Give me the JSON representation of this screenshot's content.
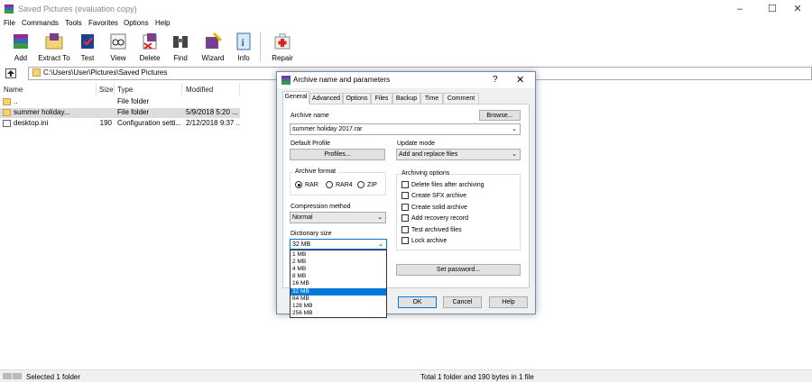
{
  "window": {
    "title": "Saved Pictures (evaluation copy)",
    "controls": [
      "–",
      "☐",
      "✕"
    ]
  },
  "menu": [
    "File",
    "Commands",
    "Tools",
    "Favorites",
    "Options",
    "Help"
  ],
  "toolbar": {
    "buttons": [
      {
        "label": "Add",
        "icon": "winrar-add-icon"
      },
      {
        "label": "Extract To",
        "icon": "extract-folder-icon"
      },
      {
        "label": "Test",
        "icon": "test-book-icon"
      },
      {
        "label": "View",
        "icon": "view-glasses-icon"
      },
      {
        "label": "Delete",
        "icon": "delete-icon"
      },
      {
        "label": "Find",
        "icon": "binoculars-icon"
      },
      {
        "label": "Wizard",
        "icon": "wizard-icon"
      },
      {
        "label": "Info",
        "icon": "info-icon"
      },
      {
        "label": "Repair",
        "icon": "first-aid-kit-icon"
      }
    ]
  },
  "address": {
    "path": "C:\\Users\\User\\Pictures\\Saved Pictures"
  },
  "filelist": {
    "columns": [
      "Name",
      "Size",
      "Type",
      "Modified"
    ],
    "rows": [
      {
        "name": "..",
        "size": "",
        "type": "File folder",
        "modified": "",
        "icon": "folder-icon"
      },
      {
        "name": "summer holiday...",
        "size": "",
        "type": "File folder",
        "modified": "5/9/2018 5:20 ...",
        "icon": "folder-icon"
      },
      {
        "name": "desktop.ini",
        "size": "190",
        "type": "Configuration setti...",
        "modified": "2/12/2018 9:37 ...",
        "icon": "settings-file-icon"
      }
    ]
  },
  "status": {
    "left": "Selected 1 folder",
    "right": "Total 1 folder and 190 bytes in 1 file"
  },
  "dialog": {
    "title": "Archive name and parameters",
    "help": "?",
    "close": "✕",
    "tabs": [
      "General",
      "Advanced",
      "Options",
      "Files",
      "Backup",
      "Time",
      "Comment"
    ],
    "archive_name_label": "Archive name",
    "browse_label": "Browse...",
    "archive_name_value": "summer holiday 2017.rar",
    "default_profile_label": "Default Profile",
    "profiles_label": "Profiles...",
    "update_mode_label": "Update mode",
    "update_mode_value": "Add and replace files",
    "archive_format_label": "Archive format",
    "formats": [
      "RAR",
      "RAR4",
      "ZIP"
    ],
    "selected_format": "RAR",
    "archiving_options_label": "Archiving options",
    "options": [
      "Delete files after archiving",
      "Create SFX archive",
      "Create solid archive",
      "Add recovery record",
      "Test archived files",
      "Lock archive"
    ],
    "compression_method_label": "Compression method",
    "compression_method_value": "Normal",
    "dictionary_size_label": "Dictionary size",
    "dictionary_size_value": "32 MB",
    "dictionary_options": [
      "1 MB",
      "2 MB",
      "4 MB",
      "8 MB",
      "16 MB",
      "32 MB",
      "64 MB",
      "128 MB",
      "256 MB"
    ],
    "set_password_label": "Set password...",
    "ok_label": "OK",
    "cancel_label": "Cancel",
    "help_label": "Help"
  }
}
